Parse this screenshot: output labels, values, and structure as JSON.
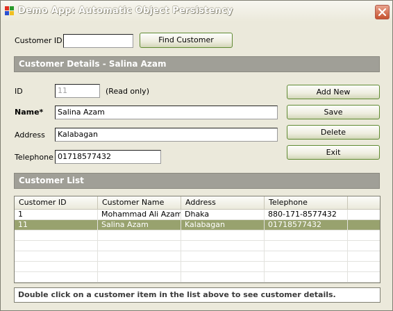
{
  "window": {
    "title": "Demo App: Automatic Object Persistency",
    "icon": "app-window-icon",
    "close_icon": "close-icon"
  },
  "search": {
    "label": "Customer ID:",
    "value": "",
    "button": "Find Customer"
  },
  "details": {
    "header": "Customer Details - Salina Azam",
    "id_label": "ID",
    "id_value": "11",
    "readonly_note": "(Read only)",
    "name_label": "Name*",
    "name_value": "Salina Azam",
    "address_label": "Address",
    "address_value": "Kalabagan",
    "telephone_label": "Telephone",
    "telephone_value": "01718577432"
  },
  "actions": {
    "add_new": "Add New",
    "save": "Save",
    "delete": "Delete",
    "exit": "Exit"
  },
  "list": {
    "header": "Customer List",
    "columns": [
      "Customer ID",
      "Customer Name",
      "Address",
      "Telephone"
    ],
    "rows": [
      {
        "id": "1",
        "name": "Mohammad  Ali Azam",
        "address": "Dhaka",
        "telephone": "880-171-8577432",
        "selected": false
      },
      {
        "id": "11",
        "name": "Salina Azam",
        "address": "Kalabagan",
        "telephone": "01718577432",
        "selected": true
      }
    ]
  },
  "status": {
    "text": "Double click on a customer item in the list above to see customer details."
  },
  "colors": {
    "selection": "#98a26e",
    "section_header": "#a09f97",
    "window_bg": "#ebe9db"
  }
}
